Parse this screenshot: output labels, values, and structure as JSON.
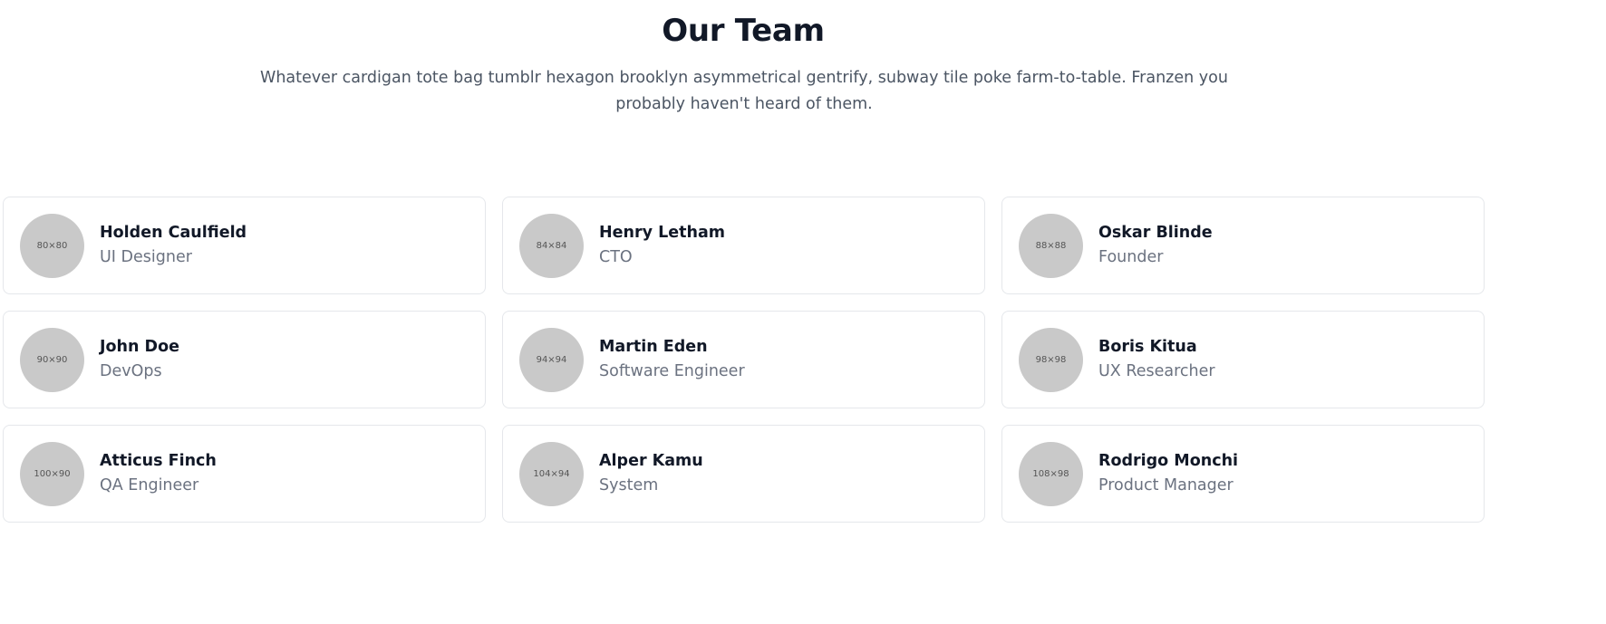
{
  "header": {
    "title": "Our Team",
    "subtitle": "Whatever cardigan tote bag tumblr hexagon brooklyn asymmetrical gentrify, subway tile poke farm-to-table. Franzen you probably haven't heard of them."
  },
  "team": [
    {
      "name": "Holden Caulfield",
      "role": "UI Designer",
      "avatar_label": "80×80"
    },
    {
      "name": "Henry Letham",
      "role": "CTO",
      "avatar_label": "84×84"
    },
    {
      "name": "Oskar Blinde",
      "role": "Founder",
      "avatar_label": "88×88"
    },
    {
      "name": "John Doe",
      "role": "DevOps",
      "avatar_label": "90×90"
    },
    {
      "name": "Martin Eden",
      "role": "Software Engineer",
      "avatar_label": "94×94"
    },
    {
      "name": "Boris Kitua",
      "role": "UX Researcher",
      "avatar_label": "98×98"
    },
    {
      "name": "Atticus Finch",
      "role": "QA Engineer",
      "avatar_label": "100×90"
    },
    {
      "name": "Alper Kamu",
      "role": "System",
      "avatar_label": "104×94"
    },
    {
      "name": "Rodrigo Monchi",
      "role": "Product Manager",
      "avatar_label": "108×98"
    }
  ]
}
